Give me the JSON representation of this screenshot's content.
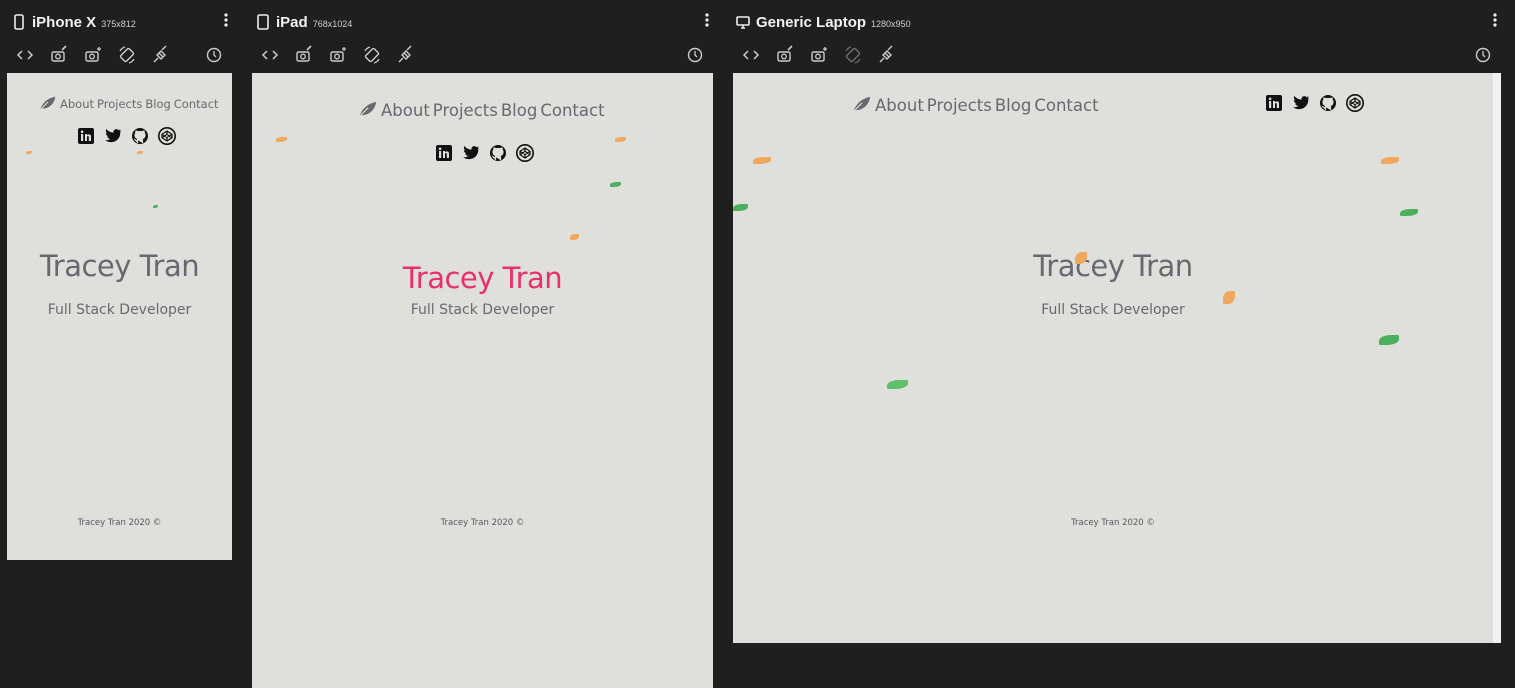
{
  "devices": [
    {
      "name": "iPhone X",
      "size": "375x812"
    },
    {
      "name": "iPad",
      "size": "768x1024"
    },
    {
      "name": "Generic Laptop",
      "size": "1280x950"
    }
  ],
  "site": {
    "nav": [
      "About",
      "Projects",
      "Blog",
      "Contact"
    ],
    "name": "Tracey Tran",
    "role": "Full Stack Developer",
    "footer": "Tracey Tran 2020 ©",
    "socials": [
      "linkedin-icon",
      "twitter-icon",
      "github-icon",
      "codepen-icon"
    ],
    "colors": {
      "background": "#dfdfdb",
      "text": "#6b6770",
      "highlight": "#e8306e",
      "orange_leaf": "#f0a860",
      "green_leaf": "#4caf5c"
    }
  },
  "toolbar_icons": [
    "code-icon",
    "camera-edit-icon",
    "camera-plus-icon",
    "rotate-icon",
    "plug-icon",
    "refresh-icon"
  ]
}
